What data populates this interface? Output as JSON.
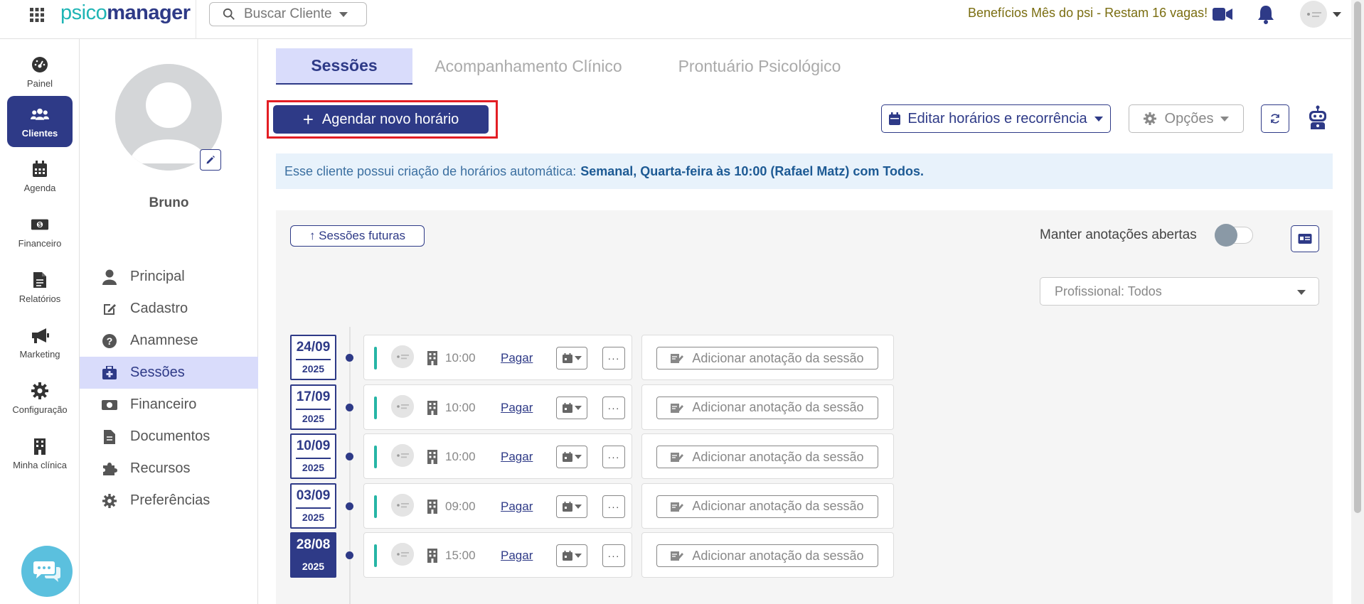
{
  "topbar": {
    "logo_part1": "psico",
    "logo_part2": "manager",
    "search_placeholder": "Buscar Cliente",
    "promo_text": "Benefícios Mês do psi - Restam 16 vagas!"
  },
  "rail": {
    "items": [
      {
        "label": "Painel",
        "icon": "dashboard-icon"
      },
      {
        "label": "Clientes",
        "icon": "users-icon",
        "active": true
      },
      {
        "label": "Agenda",
        "icon": "calendar-icon"
      },
      {
        "label": "Financeiro",
        "icon": "money-icon"
      },
      {
        "label": "Relatórios",
        "icon": "document-icon"
      },
      {
        "label": "Marketing",
        "icon": "megaphone-icon"
      },
      {
        "label": "Configuração",
        "icon": "gear-icon"
      },
      {
        "label": "Minha clínica",
        "icon": "building-icon"
      }
    ]
  },
  "client": {
    "name": "Bruno",
    "menu": [
      {
        "label": "Principal",
        "icon": "user-icon"
      },
      {
        "label": "Cadastro",
        "icon": "edit-icon"
      },
      {
        "label": "Anamnese",
        "icon": "question-icon"
      },
      {
        "label": "Sessões",
        "icon": "briefcase-medical-icon",
        "active": true
      },
      {
        "label": "Financeiro",
        "icon": "money-icon"
      },
      {
        "label": "Documentos",
        "icon": "file-icon"
      },
      {
        "label": "Recursos",
        "icon": "puzzle-icon"
      },
      {
        "label": "Preferências",
        "icon": "gear-icon"
      }
    ]
  },
  "tabs": [
    {
      "label": "Sessões",
      "active": true
    },
    {
      "label": "Acompanhamento Clínico"
    },
    {
      "label": "Prontuário Psicológico"
    }
  ],
  "actions": {
    "new_schedule": "Agendar novo horário",
    "edit_schedules": "Editar horários e recorrência",
    "options": "Opções"
  },
  "info": {
    "prefix": "Esse cliente possui criação de horários automática:",
    "detail": "Semanal, Quarta-feira às 10:00 (Rafael Matz) com Todos."
  },
  "sessions_panel": {
    "future_button": "↑ Sessões futuras",
    "keep_notes_label": "Manter anotações abertas",
    "keep_notes_on": false,
    "professional_filter": "Profissional: Todos",
    "pay_label": "Pagar",
    "note_button": "Adicionar anotação da sessão",
    "sessions": [
      {
        "date": "24/09",
        "year": "2025",
        "time": "10:00"
      },
      {
        "date": "17/09",
        "year": "2025",
        "time": "10:00"
      },
      {
        "date": "10/09",
        "year": "2025",
        "time": "10:00"
      },
      {
        "date": "03/09",
        "year": "2025",
        "time": "09:00"
      },
      {
        "date": "28/08",
        "year": "2025",
        "time": "15:00",
        "highlighted": true
      }
    ]
  },
  "colors": {
    "primary": "#2e3a87",
    "accent_teal": "#1fb5b5",
    "highlight_border": "#e31e24",
    "tab_active_bg": "#d9dcfb",
    "info_bg": "#e8f2fb",
    "promo_text": "#7a6d10"
  }
}
